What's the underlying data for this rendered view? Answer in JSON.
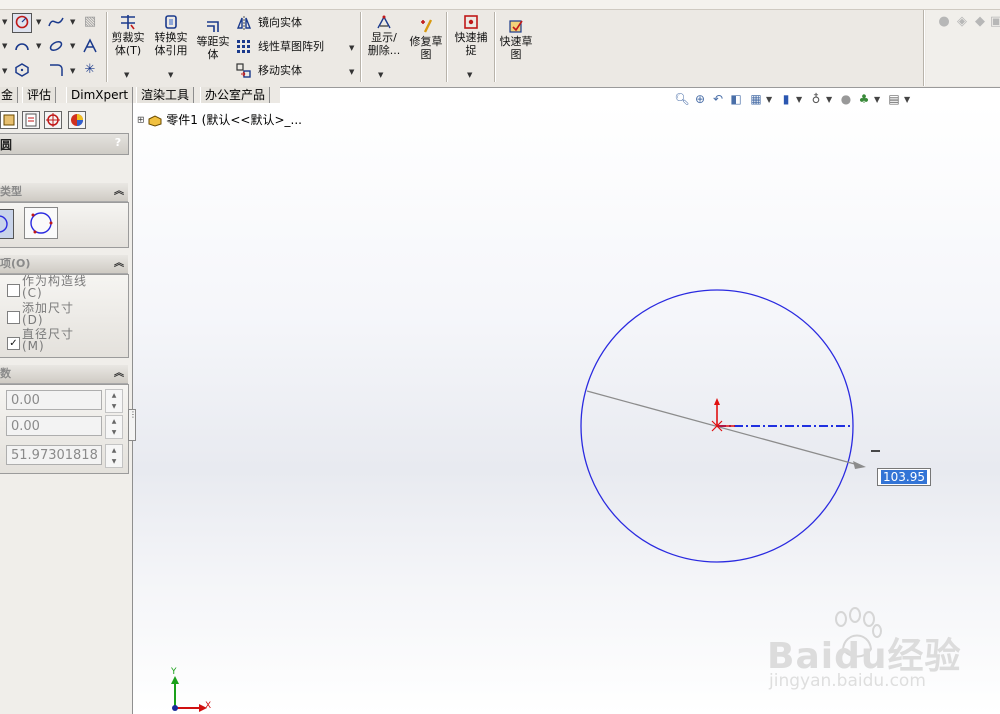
{
  "toolbar": {
    "buttons": {
      "trim": "剪裁实\n体(T)",
      "convert": "转换实\n体引用",
      "offset": "等距实\n体",
      "mirror": "镜向实体",
      "linear_pattern": "线性草图阵列",
      "move": "移动实体",
      "show_delete": "显示/\n删除...",
      "repair": "修复草\n图",
      "quick_snap": "快速捕\n捉",
      "rapid_sketch": "快速草\n图"
    }
  },
  "tabs": [
    "金",
    "评估",
    "DimXpert",
    "渲染工具",
    "办公室产品"
  ],
  "tree": {
    "part_label": "零件1  (默认<<默认>_..."
  },
  "panel": {
    "title": "圆",
    "help": "?",
    "type_section": "类型",
    "options_section": "项(O)",
    "options": [
      {
        "label": "作为构造线\n(C)",
        "checked": false
      },
      {
        "label": "添加尺寸\n(D)",
        "checked": false
      },
      {
        "label": "直径尺寸\n(M)",
        "checked": true
      }
    ],
    "params_section": "数",
    "params": [
      "0.00",
      "0.00",
      "51.97301818"
    ]
  },
  "viewport": {
    "dimension_value": "103.95",
    "axis_x": "X",
    "axis_y": "Y",
    "circle_color": "#2a2ae0",
    "watermark_line1": "Baidu经验",
    "watermark_line2": "jingyan.baidu.com"
  }
}
